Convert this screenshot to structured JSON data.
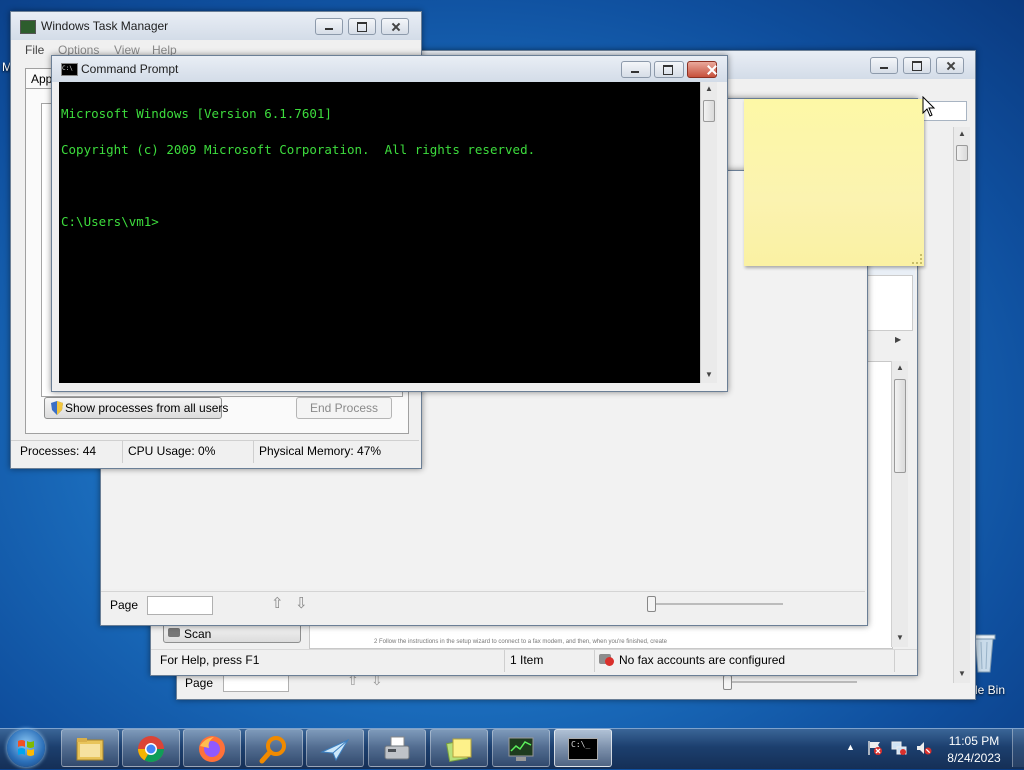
{
  "task_manager": {
    "title": "Windows Task Manager",
    "menu": [
      "File",
      "Options",
      "View",
      "Help"
    ],
    "tab_partial": "App",
    "show_all_button": "Show processes from all users",
    "end_process_button": "End Process",
    "status": {
      "processes": "Processes: 44",
      "cpu": "CPU Usage: 0%",
      "memory": "Physical Memory: 47%"
    }
  },
  "cmd": {
    "title": "Command Prompt",
    "lines": [
      "Microsoft Windows [Version 6.1.7601]",
      "Copyright (c) 2009 Microsoft Corporation.  All rights reserved.",
      "",
      "C:\\Users\\vm1>"
    ],
    "icon_text": "C:\\"
  },
  "desktop": {
    "left_edge_partial": "M"
  },
  "viewer_front": {
    "page_label": "Page"
  },
  "fax": {
    "scan_label": "Scan",
    "status": {
      "help": "For Help, press F1",
      "items": "1 Item",
      "accounts": "No fax accounts are configured"
    },
    "doc_snippet": "2    Follow the instructions in the setup wizard to connect to a fax modem, and then, when you're finished, create"
  },
  "viewer_back": {
    "page_label": "Page"
  },
  "recycle_bin_partial": "le Bin",
  "taskbar": {
    "time": "11:05 PM",
    "date": "8/24/2023",
    "apps": [
      "start-orb",
      "file-explorer",
      "chrome",
      "firefox",
      "search-magnifier",
      "paper-plane",
      "fax-and-scan",
      "sticky-notes",
      "task-manager",
      "command-prompt"
    ],
    "cmd_icon_text": "C:\\_"
  },
  "colors": {
    "console_text": "#3ddc3d",
    "sticky_note": "#fdf8a6",
    "taskbar": "#1c3f6e"
  }
}
